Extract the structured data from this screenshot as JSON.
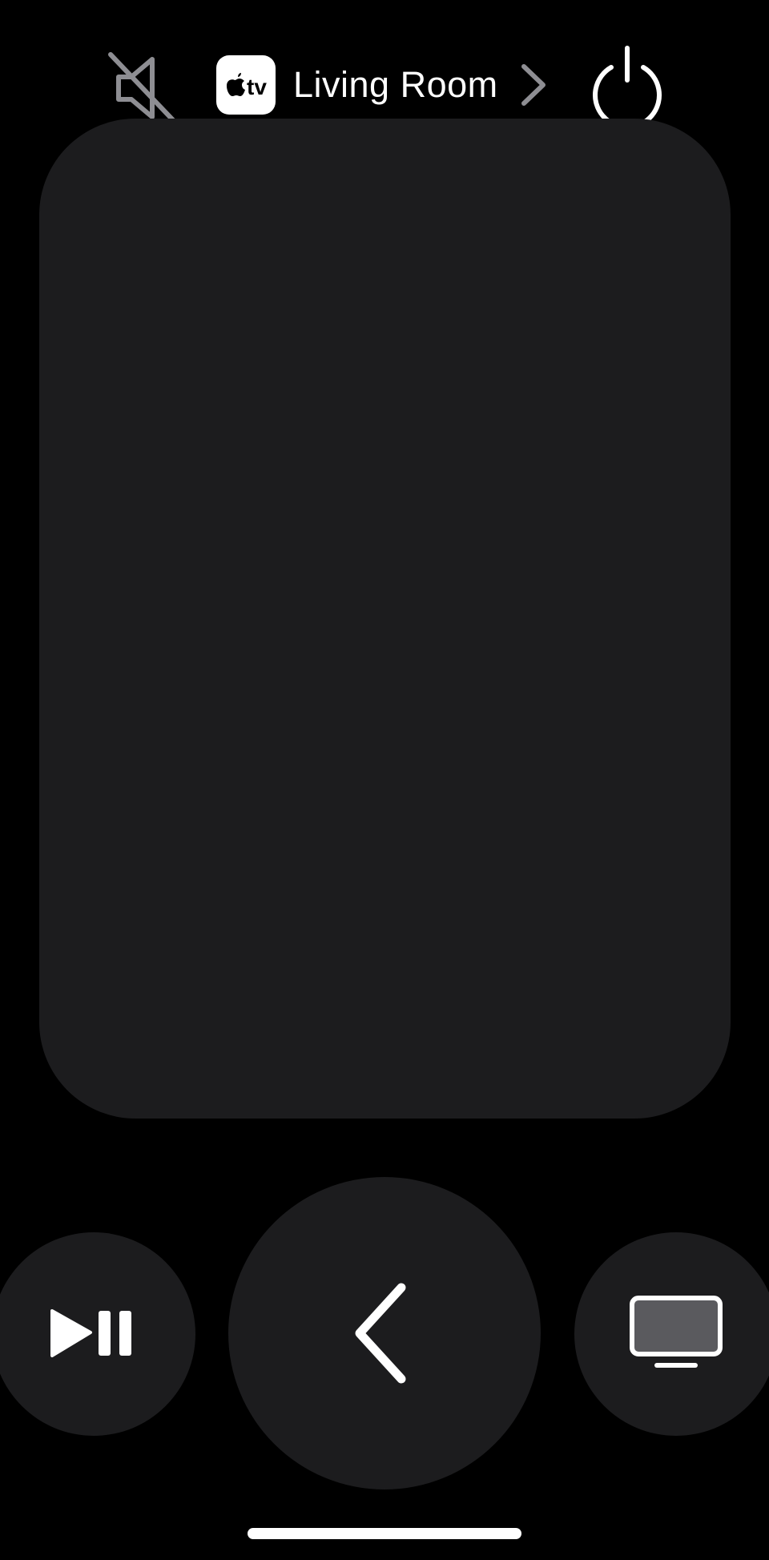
{
  "top_bar": {
    "mute": {
      "icon": "speaker-muted-icon",
      "color": "#8e8e93"
    },
    "device": {
      "badge_icon": "apple-tv-icon",
      "badge_label": "tv",
      "name": "Living Room",
      "chevron_icon": "chevron-right-icon",
      "chevron_color": "#8e8e93"
    },
    "power": {
      "icon": "power-icon",
      "color": "#ffffff"
    }
  },
  "touch_surface": {
    "color": "#1c1c1e"
  },
  "controls": {
    "play_pause": {
      "icon": "play-pause-icon"
    },
    "back": {
      "icon": "chevron-left-icon"
    },
    "tv": {
      "icon": "tv-icon"
    }
  },
  "colors": {
    "background": "#000000",
    "surface": "#1c1c1e",
    "foreground": "#ffffff",
    "muted": "#8e8e93"
  }
}
